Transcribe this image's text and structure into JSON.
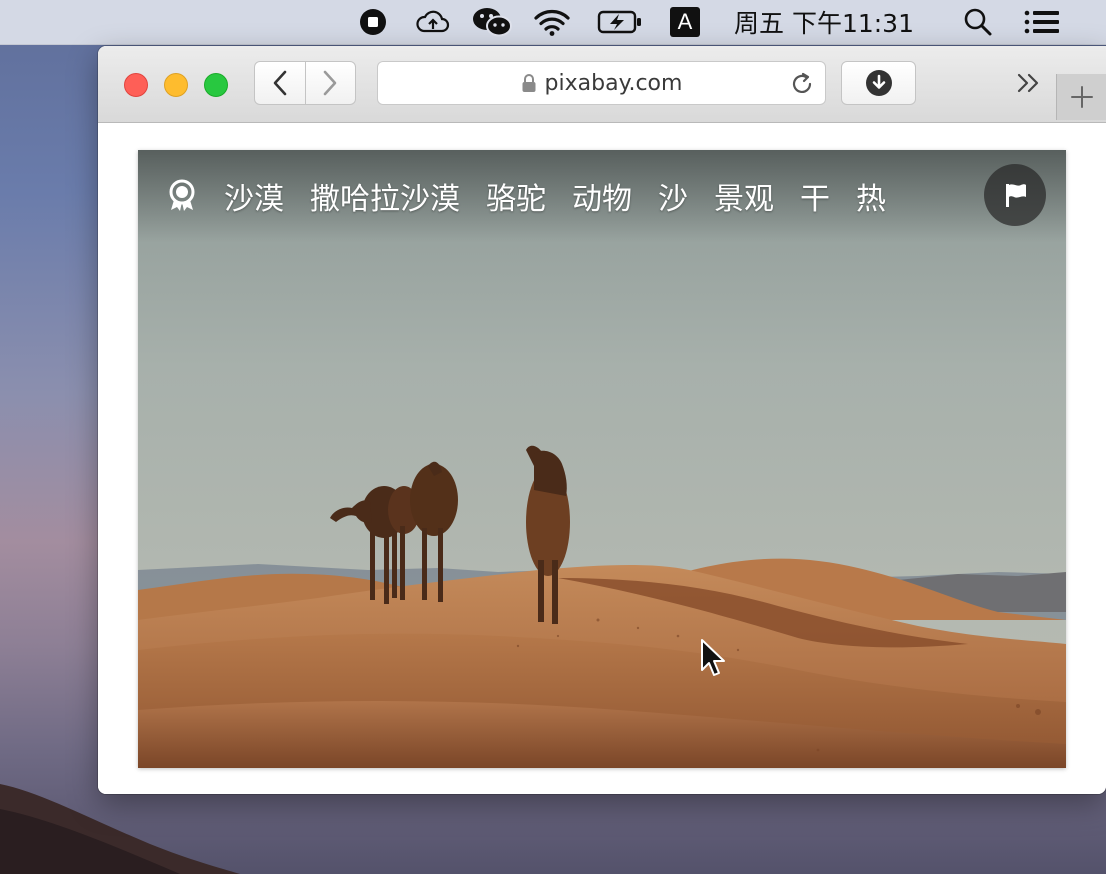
{
  "menubar": {
    "datetime": "周五 下午11:31",
    "input_method_label": "A",
    "icons": [
      "screen-record-icon",
      "cloud-upload-icon",
      "wechat-icon",
      "wifi-icon",
      "battery-charging-icon",
      "input-method-icon",
      "spotlight-search-icon",
      "control-list-icon"
    ]
  },
  "browser": {
    "url": "pixabay.com",
    "icons": [
      "back-icon",
      "forward-icon",
      "lock-icon",
      "reload-icon",
      "download-icon",
      "overflow-chevrons-icon",
      "new-tab-plus-icon"
    ]
  },
  "photo": {
    "tags": [
      "沙漠",
      "撒哈拉沙漠",
      "骆驼",
      "动物",
      "沙",
      "景观",
      "干",
      "热"
    ],
    "icons": [
      "award-icon",
      "flag-icon"
    ],
    "colors": {
      "sky": "#a9b2ad",
      "sand": "#b77a49",
      "sand_shadow": "#8e5430"
    }
  }
}
